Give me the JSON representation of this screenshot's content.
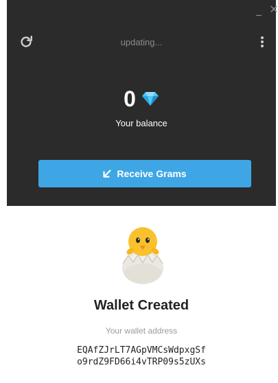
{
  "titlebar": {
    "minimize_glyph": "_",
    "close_glyph": "✕"
  },
  "header": {
    "status": "updating...",
    "refresh_icon": "refresh-icon",
    "menu_icon": "more-vertical-icon"
  },
  "balance": {
    "value": "0",
    "currency_icon": "diamond-icon",
    "label": "Your balance"
  },
  "receive_button": {
    "label": "Receive Grams",
    "icon": "arrow-down-left-icon"
  },
  "wallet": {
    "illustration": "hatching-chick-icon",
    "title": "Wallet Created",
    "address_label": "Your wallet address",
    "address_line1": "EQAfZJrLT7AGpVMCsWdpxgSf",
    "address_line2": "o9rdZ9FD66i4vTRP09s5zUXs"
  },
  "colors": {
    "dark_bg": "#2b2b2b",
    "accent": "#3ea6e4",
    "diamond": "#4fc3f7"
  }
}
